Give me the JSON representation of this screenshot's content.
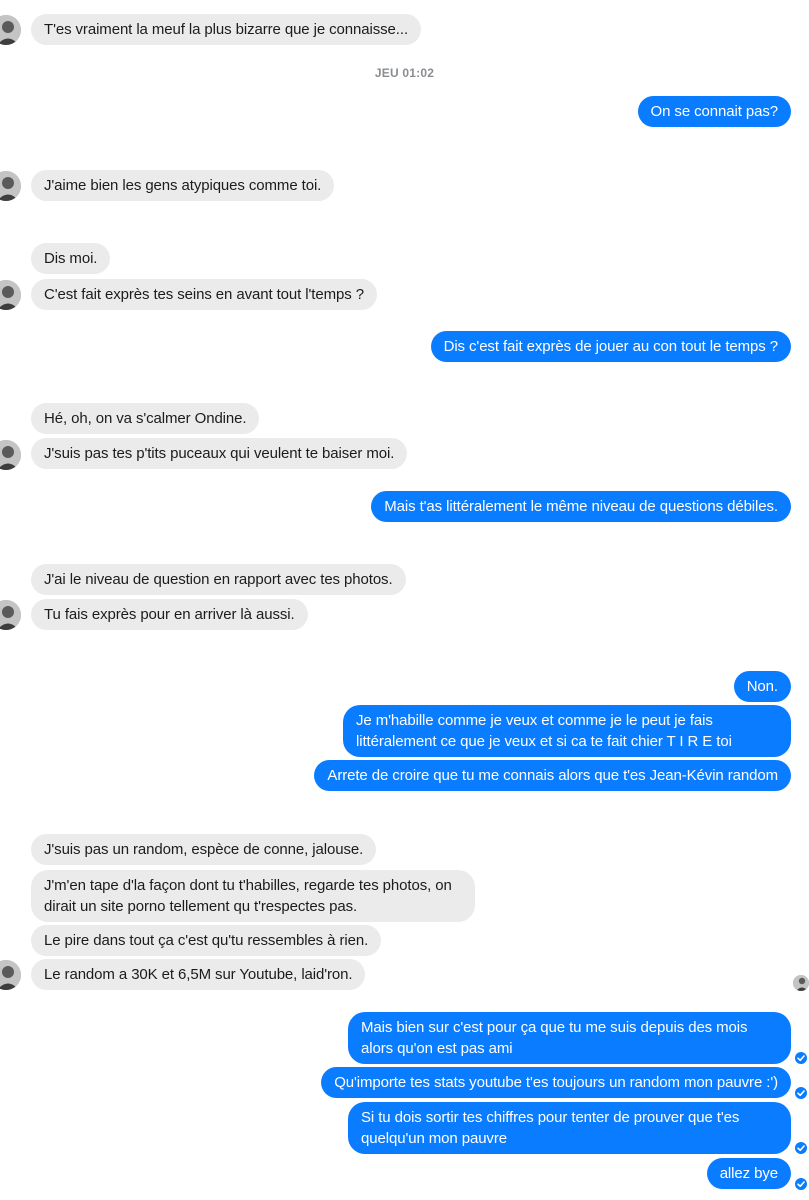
{
  "conversation": {
    "timestamp": "JEU 01:02",
    "messages": [
      {
        "dir": "in",
        "text": "T'es vraiment la meuf la plus bizarre que je connaisse..."
      },
      {
        "dir": "out",
        "text": "On se connait pas?"
      },
      {
        "dir": "in",
        "text": "J'aime bien les gens atypiques comme toi."
      },
      {
        "dir": "in",
        "text": "Dis moi."
      },
      {
        "dir": "in",
        "text": "C'est fait exprès tes seins en avant tout l'temps ?"
      },
      {
        "dir": "out",
        "text": "Dis c'est fait exprès de jouer au con tout le temps ?"
      },
      {
        "dir": "in",
        "text": "Hé, oh, on va s'calmer Ondine."
      },
      {
        "dir": "in",
        "text": "J'suis pas tes p'tits puceaux qui veulent te baiser moi."
      },
      {
        "dir": "out",
        "text": "Mais t'as littéralement le même niveau de questions débiles."
      },
      {
        "dir": "in",
        "text": "J'ai le niveau de question en rapport avec tes photos."
      },
      {
        "dir": "in",
        "text": "Tu fais exprès pour en arriver là aussi."
      },
      {
        "dir": "out",
        "text": "Non."
      },
      {
        "dir": "out",
        "text": "Je m'habille comme je veux et comme je le peut je fais littéralement ce que je veux et si ca te fait chier T I R E toi"
      },
      {
        "dir": "out",
        "text": "Arrete de croire que tu me connais alors que t'es Jean-Kévin random"
      },
      {
        "dir": "in",
        "text": "J'suis pas un random, espèce de conne, jalouse."
      },
      {
        "dir": "in",
        "text": "J'm'en tape d'la façon dont tu t'habilles, regarde tes photos, on dirait un site porno tellement qu t'respectes pas."
      },
      {
        "dir": "in",
        "text": "Le pire dans tout ça c'est qu'tu ressembles à rien."
      },
      {
        "dir": "in",
        "text": "Le random a 30K et 6,5M sur Youtube, laid'ron."
      },
      {
        "dir": "out",
        "text": "Mais bien sur c'est pour ça que tu me suis depuis des mois alors qu'on est pas ami"
      },
      {
        "dir": "out",
        "text": "Qu'importe tes stats youtube t'es toujours un random mon pauvre :')"
      },
      {
        "dir": "out",
        "text": "Si tu dois sortir tes chiffres pour tenter de prouver que t'es quelqu'un mon pauvre"
      },
      {
        "dir": "out",
        "text": "allez bye"
      }
    ]
  },
  "icons": {
    "avatar": "avatar-icon",
    "read_receipt": "check-circle-icon"
  },
  "colors": {
    "outgoing_bubble": "#0a7cff",
    "incoming_bubble": "#ebebeb",
    "timestamp": "#8a8d91"
  }
}
